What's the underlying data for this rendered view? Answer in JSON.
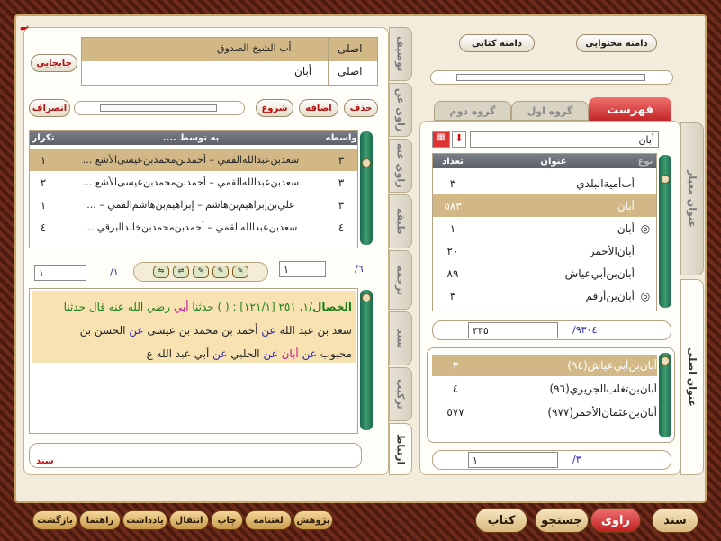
{
  "header": {
    "btn_mabjaei": "جابجایی",
    "btn_dameneh_mohtavaei": "دامنه محتوایی",
    "btn_dameneh_ketabi": "دامنه کتابی",
    "info_row1_label": "اصلی",
    "info_row1_value": "أب الشيخ الصدوق",
    "info_row2_label": "اصلی",
    "info_row2_value": "أبان"
  },
  "toolbar": {
    "hazf": "حذف",
    "ezafeh": "اضافه",
    "shoru": "شروع",
    "enseraf": "انصراف"
  },
  "vertical_tabs": {
    "tosif": "توصیف",
    "ravi_an": "راوی عن",
    "ravi_anhu": "راوی عنه",
    "tabaqeh": "طبقه",
    "tarjomeh": "ترجمه",
    "sanad": "سند",
    "tarkib": "ترکیب",
    "ertebat": "ارتباط",
    "onvan_meyar": "عنوان معیار",
    "onvan_asli": "عنوان اصلی"
  },
  "chain_table": {
    "headers": {
      "vaseteh": "واسطه",
      "be_tavasot": "به توسط ....",
      "tekrar": "تکرار"
    },
    "rows": [
      {
        "vaseteh": "٣",
        "name": "سعدبن‌عبدالله‌القمي – أحمدبن‌محمدبن‌عيسى‌الأشع ...",
        "tekrar": "١"
      },
      {
        "vaseteh": "٣",
        "name": "سعدبن‌عبدالله‌القمي – أحمدبن‌محمدبن‌عيسى‌الأشع ...",
        "tekrar": "٢"
      },
      {
        "vaseteh": "٣",
        "name": "علي‌بن‌إبراهيم‌بن‌هاشم – إبراهيم‌بن‌هاشم‌القمي – ...",
        "tekrar": "١"
      },
      {
        "vaseteh": "٤",
        "name": "سعدبن‌عبدالله‌القمي – أحمدبن‌محمدبن‌خالدالبرقي ...",
        "tekrar": "٤"
      }
    ]
  },
  "chain_pager": {
    "current": "١",
    "total": "/٦",
    "right_current": "١",
    "right_total": "/١"
  },
  "hadith": {
    "source": "الخصال",
    "ref1": "/١، ٢٥١",
    "ref2": "[١٢١/١]",
    "marker": ": ( )",
    "haddathana": "حدثنا",
    "abi": "أبي",
    "radhi": "رضي الله عنه",
    "qala": "قال",
    "haddathana2": "حدثنا",
    "line2": "سعد بن عبد الله",
    "an1": "عن",
    "ahmad": "أحمد بن محمد بن عيسى",
    "an2": "عن",
    "hasan": "الحسن بن",
    "line3a": "محبوب",
    "an3": "عن",
    "aban": "أبان",
    "an4": "عن",
    "halabi": "الحلبي",
    "an5": "عن",
    "abi_abdillah": "أبي عبد الله ع",
    "footer_tag": "سند"
  },
  "right_tabs": {
    "fehrest": "فهرست",
    "group1": "گروه اول",
    "group2": "گروه دوم"
  },
  "search": {
    "value": "أبان"
  },
  "names_table": {
    "headers": {
      "no": "نوع",
      "onvan": "عنوان",
      "tedad": "تعداد"
    },
    "rows": [
      {
        "mark": "",
        "name": "أب‌أمية‌البلدي",
        "count": "٣"
      },
      {
        "mark": "",
        "name": "أبان",
        "count": "٥٨٣",
        "selected": true
      },
      {
        "mark": "◎",
        "name": "أبان",
        "count": "١"
      },
      {
        "mark": "",
        "name": "أبان‌الأحمر",
        "count": "٢٠"
      },
      {
        "mark": "",
        "name": "أبان‌بن‌أبي‌عياش",
        "count": "٨٩"
      },
      {
        "mark": "◎",
        "name": "أبان‌بن‌أرقم",
        "count": "٣"
      }
    ]
  },
  "names_pager": {
    "current": "٣٣٥",
    "total": "/٩٣٠٤"
  },
  "asli_table": {
    "rows": [
      {
        "name": "أبان‌بن‌أبي‌عياش(٩٤)",
        "count": "٣",
        "selected": true
      },
      {
        "name": "أبان‌بن‌تغلب‌الجريري(٩٦)",
        "count": "٤"
      },
      {
        "name": "أبان‌بن‌عثمان‌الأحمر(٩٧٧)",
        "count": "٥٧٧"
      }
    ]
  },
  "asli_pager": {
    "current": "١",
    "total": "/٣"
  },
  "bottom_bar": {
    "pazhoohesh": "پژوهش",
    "loghatnameh": "لغتنامه",
    "chap": "چاپ",
    "enteqal": "انتقال",
    "yaddasht": "یادداشت",
    "rahnama": "راهنما",
    "bazgasht": "بازگشت",
    "sanad": "سند",
    "ravi": "راوی",
    "jostejoo": "جستجو",
    "ketab": "کتاب"
  },
  "colors": {
    "selected_row": "#d3b887",
    "header_gray": "#5c6068",
    "active_tab": "#e03030"
  }
}
